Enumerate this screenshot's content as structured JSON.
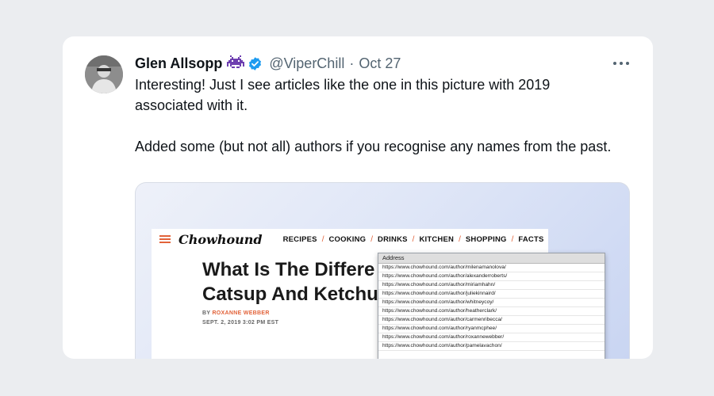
{
  "tweet": {
    "author_name": "Glen Allsopp",
    "handle": "@ViperChill",
    "separator": "·",
    "date": "Oct 27",
    "paragraphs": [
      "Interesting! Just I see articles like the one in this picture with 2019 associated with it.",
      "Added some (but not all) authors if you recognise any names from the past."
    ],
    "icons": {
      "badge": "alien-emoji-icon",
      "verified": "verified-badge-icon",
      "more": "more-options-icon",
      "verified_color": "#1d9bf0"
    }
  },
  "media": {
    "site": {
      "logo": "Chowhound",
      "nav": [
        "RECIPES",
        "COOKING",
        "DRINKS",
        "KITCHEN",
        "SHOPPING",
        "FACTS"
      ],
      "nav_separator": "/",
      "title": "What Is The Differe\nCatsup And Ketchu",
      "byline_prefix": "BY",
      "byline_author": "ROXANNE WEBBER",
      "dateline": "SEPT. 2, 2019 3:02 PM EST",
      "accent_color": "#e2633a"
    },
    "address_list": {
      "header": "Address",
      "rows": [
        "https://www.chowhound.com/author/milenamanolova/",
        "https://www.chowhound.com/author/alexanderroberts/",
        "https://www.chowhound.com/author/miriamhahn/",
        "https://www.chowhound.com/author/juliekinnaird/",
        "https://www.chowhound.com/author/whitneycoy/",
        "https://www.chowhound.com/author/heatherclark/",
        "https://www.chowhound.com/author/carmenribecca/",
        "https://www.chowhound.com/author/ryanmcphee/",
        "https://www.chowhound.com/author/roxannewebber/",
        "https://www.chowhound.com/author/pamelavachon/"
      ]
    }
  }
}
